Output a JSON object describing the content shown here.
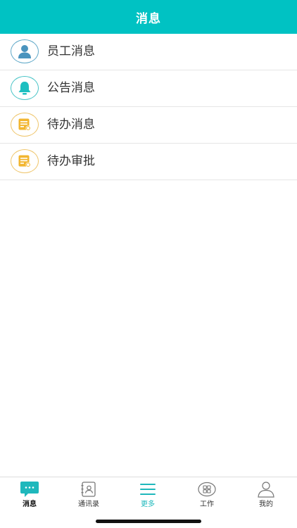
{
  "header": {
    "title": "消息"
  },
  "list": {
    "items": [
      {
        "label": "员工消息",
        "icon": "person-icon"
      },
      {
        "label": "公告消息",
        "icon": "bell-icon"
      },
      {
        "label": "待办消息",
        "icon": "memo-icon"
      },
      {
        "label": "待办审批",
        "icon": "memo-icon"
      }
    ]
  },
  "tabbar": {
    "tabs": [
      {
        "label": "消息",
        "icon": "chat-bubble-icon",
        "active": true
      },
      {
        "label": "通讯录",
        "icon": "contacts-book-icon"
      },
      {
        "label": "更多",
        "icon": "menu-lines-icon"
      },
      {
        "label": "工作",
        "icon": "grid-icon"
      },
      {
        "label": "我的",
        "icon": "user-icon"
      }
    ]
  },
  "colors": {
    "header_bg": "#00c2c3",
    "accent_teal": "#1fb8bc",
    "icon_blue": "#4a94be",
    "icon_gold": "#f2b630",
    "divider": "#e6e6e6"
  }
}
